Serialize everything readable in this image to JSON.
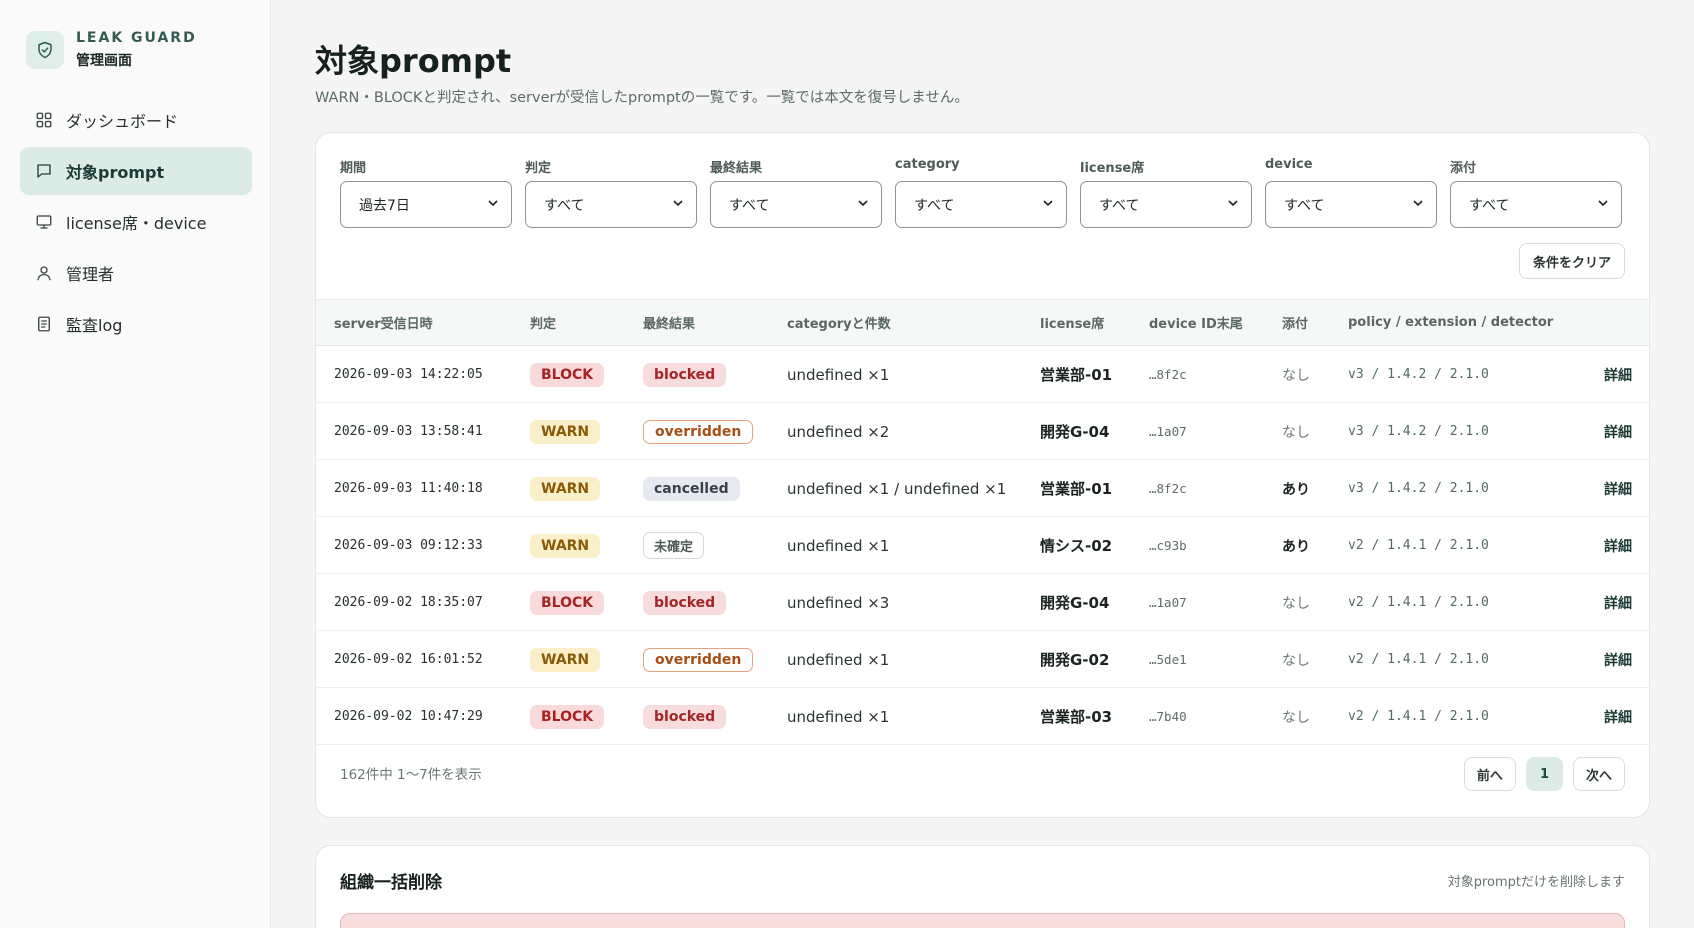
{
  "brand": {
    "name": "LEAK GUARD",
    "subtitle": "管理画面"
  },
  "sidebar": {
    "items": [
      {
        "label": "ダッシュボード",
        "icon": "dashboard-grid-icon",
        "active": false
      },
      {
        "label": "対象prompt",
        "icon": "chat-icon",
        "active": true
      },
      {
        "label": "license席・device",
        "icon": "monitor-icon",
        "active": false
      },
      {
        "label": "管理者",
        "icon": "user-icon",
        "active": false
      },
      {
        "label": "監査log",
        "icon": "document-icon",
        "active": false
      }
    ]
  },
  "page": {
    "title": "対象prompt",
    "description": "WARN・BLOCKと判定され、serverが受信したpromptの一覧です。一覧では本文を復号しません。"
  },
  "filters": [
    {
      "label": "期間",
      "value": "過去7日"
    },
    {
      "label": "判定",
      "value": "すべて"
    },
    {
      "label": "最終結果",
      "value": "すべて"
    },
    {
      "label": "category",
      "value": "すべて"
    },
    {
      "label": "license席",
      "value": "すべて"
    },
    {
      "label": "device",
      "value": "すべて"
    },
    {
      "label": "添付",
      "value": "すべて"
    }
  ],
  "clear_label": "条件をクリア",
  "table": {
    "headers": [
      "server受信日時",
      "判定",
      "最終結果",
      "categoryと件数",
      "license席",
      "device ID末尾",
      "添付",
      "policy / extension / detector"
    ],
    "rows": [
      {
        "time": "2026-09-03 14:22:05",
        "verdict": "BLOCK",
        "result": "blocked",
        "category": "undefined ×1",
        "license": "営業部-01",
        "device": "…8f2c",
        "attachment": "なし",
        "policy": "v3 / 1.4.2 / 2.1.0",
        "detail": "詳細"
      },
      {
        "time": "2026-09-03 13:58:41",
        "verdict": "WARN",
        "result": "overridden",
        "category": "undefined ×2",
        "license": "開発G-04",
        "device": "…1a07",
        "attachment": "なし",
        "policy": "v3 / 1.4.2 / 2.1.0",
        "detail": "詳細"
      },
      {
        "time": "2026-09-03 11:40:18",
        "verdict": "WARN",
        "result": "cancelled",
        "category": "undefined ×1 / undefined ×1",
        "license": "営業部-01",
        "device": "…8f2c",
        "attachment": "あり",
        "policy": "v3 / 1.4.2 / 2.1.0",
        "detail": "詳細"
      },
      {
        "time": "2026-09-03 09:12:33",
        "verdict": "WARN",
        "result": "未確定",
        "category": "undefined ×1",
        "license": "情シス-02",
        "device": "…c93b",
        "attachment": "あり",
        "policy": "v2 / 1.4.1 / 2.1.0",
        "detail": "詳細"
      },
      {
        "time": "2026-09-02 18:35:07",
        "verdict": "BLOCK",
        "result": "blocked",
        "category": "undefined ×3",
        "license": "開発G-04",
        "device": "…1a07",
        "attachment": "なし",
        "policy": "v2 / 1.4.1 / 2.1.0",
        "detail": "詳細"
      },
      {
        "time": "2026-09-02 16:01:52",
        "verdict": "WARN",
        "result": "overridden",
        "category": "undefined ×1",
        "license": "開発G-02",
        "device": "…5de1",
        "attachment": "なし",
        "policy": "v2 / 1.4.1 / 2.1.0",
        "detail": "詳細"
      },
      {
        "time": "2026-09-02 10:47:29",
        "verdict": "BLOCK",
        "result": "blocked",
        "category": "undefined ×1",
        "license": "営業部-03",
        "device": "…7b40",
        "attachment": "なし",
        "policy": "v2 / 1.4.1 / 2.1.0",
        "detail": "詳細"
      }
    ]
  },
  "pagination": {
    "summary": "162件中 1〜7件を表示",
    "prev": "前へ",
    "current": "1",
    "next": "次へ"
  },
  "bulk_delete": {
    "title": "組織一括削除",
    "note": "対象promptだけを削除します"
  },
  "colors": {
    "accent": "#dcebe6",
    "block": "#a82424",
    "warn": "#8a5a08",
    "overridden": "#a84d16"
  }
}
